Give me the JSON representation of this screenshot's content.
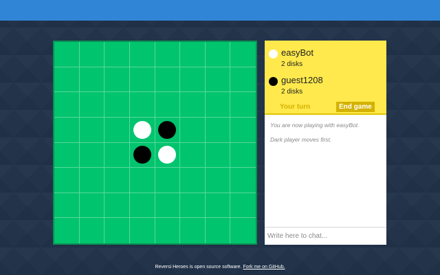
{
  "board": {
    "size": 8,
    "disks": [
      {
        "row": 3,
        "col": 3,
        "color": "white"
      },
      {
        "row": 3,
        "col": 4,
        "color": "black"
      },
      {
        "row": 4,
        "col": 3,
        "color": "black"
      },
      {
        "row": 4,
        "col": 4,
        "color": "white"
      }
    ]
  },
  "players": [
    {
      "name": "easyBot",
      "disks": "2 disks",
      "color": "white"
    },
    {
      "name": "guest1208",
      "disks": "2 disks",
      "color": "black"
    }
  ],
  "status": {
    "turn_label": "Your turn",
    "end_game_label": "End game"
  },
  "messages": [
    "You are now playing with easyBot.",
    "Dark player moves first."
  ],
  "chat": {
    "placeholder": "Write here to chat..."
  },
  "footer": {
    "text": "Reversi Heroes is open source software. ",
    "link": "Fork me on GitHub."
  },
  "colors": {
    "header": "#3185d6",
    "board": "#00c46e",
    "panel_yellow": "#ffe94d",
    "accent": "#d4b200"
  }
}
